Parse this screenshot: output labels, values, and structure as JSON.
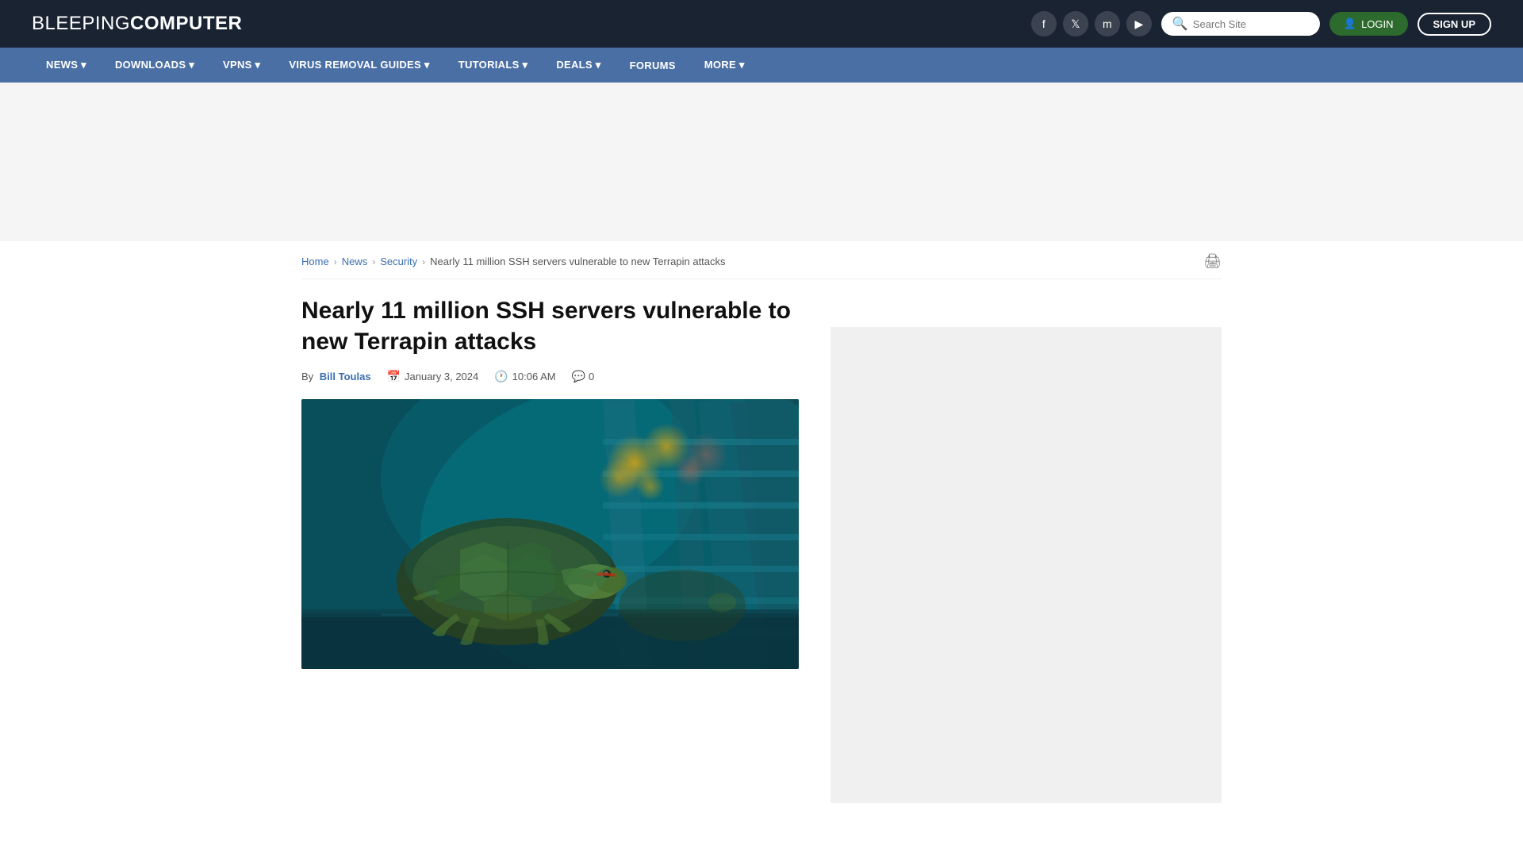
{
  "site": {
    "logo_light": "BLEEPING",
    "logo_bold": "COMPUTER"
  },
  "header": {
    "search_placeholder": "Search Site",
    "login_label": "LOGIN",
    "signup_label": "SIGN UP",
    "social": [
      {
        "name": "facebook",
        "symbol": "f"
      },
      {
        "name": "twitter",
        "symbol": "𝕏"
      },
      {
        "name": "mastodon",
        "symbol": "m"
      },
      {
        "name": "youtube",
        "symbol": "▶"
      }
    ]
  },
  "nav": {
    "items": [
      {
        "label": "NEWS ▾",
        "key": "news"
      },
      {
        "label": "DOWNLOADS ▾",
        "key": "downloads"
      },
      {
        "label": "VPNS ▾",
        "key": "vpns"
      },
      {
        "label": "VIRUS REMOVAL GUIDES ▾",
        "key": "virus"
      },
      {
        "label": "TUTORIALS ▾",
        "key": "tutorials"
      },
      {
        "label": "DEALS ▾",
        "key": "deals"
      },
      {
        "label": "FORUMS",
        "key": "forums"
      },
      {
        "label": "MORE ▾",
        "key": "more"
      }
    ]
  },
  "breadcrumb": {
    "home": "Home",
    "news": "News",
    "security": "Security",
    "current": "Nearly 11 million SSH servers vulnerable to new Terrapin attacks"
  },
  "article": {
    "title": "Nearly 11 million SSH servers vulnerable to new Terrapin attacks",
    "by_label": "By",
    "author": "Bill Toulas",
    "date": "January 3, 2024",
    "time": "10:06 AM",
    "comments": "0"
  }
}
